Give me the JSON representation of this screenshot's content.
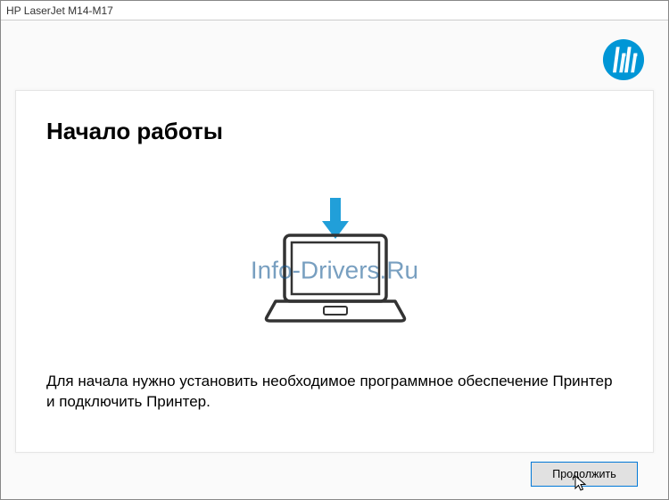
{
  "window": {
    "title": "HP LaserJet M14-M17"
  },
  "logo": {
    "name": "hp-logo"
  },
  "card": {
    "title": "Начало работы",
    "description": "Для начала нужно установить необходимое программное обеспечение Принтер и подключить Принтер."
  },
  "watermark": {
    "text": "Info-Drivers.Ru"
  },
  "buttons": {
    "continue_label": "Продолжить"
  }
}
